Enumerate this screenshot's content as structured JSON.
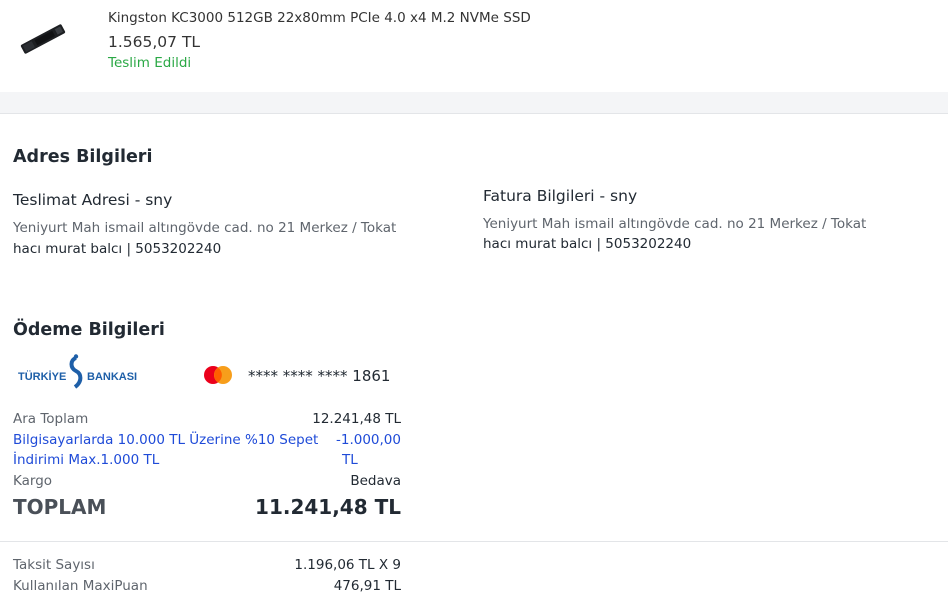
{
  "product": {
    "name": "Kingston KC3000 512GB 22x80mm PCIe 4.0 x4 M.2 NVMe SSD",
    "price": "1.565,07 TL",
    "status": "Teslim Edildi",
    "status_color": "#2aa845"
  },
  "address": {
    "section_title": "Adres Bilgileri",
    "delivery": {
      "title": "Teslimat Adresi - sny",
      "address": "Yeniyurt Mah ismail altıngövde cad. no 21 Merkez / Tokat",
      "contact": "hacı murat balcı | 5053202240"
    },
    "billing": {
      "title": "Fatura Bilgileri - sny",
      "address": "Yeniyurt Mah ismail altıngövde cad. no 21 Merkez / Tokat",
      "contact": "hacı murat balcı | 5053202240"
    }
  },
  "payment": {
    "section_title": "Ödeme Bilgileri",
    "bank_logo_text_left": "TÜRKİYE",
    "bank_logo_text_right": "BANKASI",
    "bank_logo_color": "#1e5fa8",
    "card_brand_icon": "mastercard-icon",
    "card_number": "**** **** **** 1861",
    "subtotal_label": "Ara Toplam",
    "subtotal_value": "12.241,48 TL",
    "discount_label_line1": "Bilgisayarlarda 10.000 TL Üzerine %10 Sepet",
    "discount_label_line2": "İndirimi Max.1.000 TL",
    "discount_value_line1": "-1.000,00",
    "discount_value_line2": "TL",
    "discount_color": "#1f4bd8",
    "shipping_label": "Kargo",
    "shipping_value": "Bedava",
    "total_label": "TOPLAM",
    "total_value": "11.241,48 TL",
    "installment_label": "Taksit Sayısı",
    "installment_value": "1.196,06 TL X 9",
    "points_label": "Kullanılan MaxiPuan",
    "points_value": "476,91 TL"
  }
}
